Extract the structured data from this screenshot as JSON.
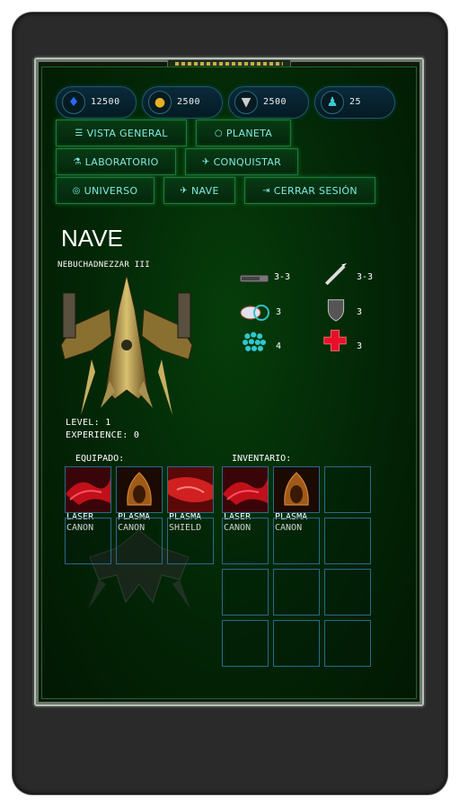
{
  "resources": [
    {
      "icon": "crystal-icon",
      "value": "12500",
      "color": "#2a6aff"
    },
    {
      "icon": "gold-icon",
      "value": "2500",
      "color": "#e8b020"
    },
    {
      "icon": "oil-icon",
      "value": "2500",
      "color": "#cccccc"
    },
    {
      "icon": "population-icon",
      "value": "25",
      "color": "#40c8d0"
    }
  ],
  "nav": {
    "vista_general": "VISTA GENERAL",
    "planeta": "PLANETA",
    "laboratorio": "LABORATORIO",
    "conquistar": "CONQUISTAR",
    "universo": "UNIVERSO",
    "nave": "NAVE",
    "cerrar_sesion": "CERRAR SESIÓN"
  },
  "page": {
    "title": "NAVE",
    "ship_name": "NEBUCHADNEZZAR III"
  },
  "stats": {
    "cannon": "3-3",
    "missile": "3-3",
    "thruster": "3",
    "shield": "3",
    "cells": "4",
    "repair": "3"
  },
  "ship_info": {
    "level": "LEVEL: 1",
    "experience": "EXPERIENCE: 0"
  },
  "equipped": {
    "label": "EQUIPADO:",
    "items": [
      {
        "name": "LASER\nCANON",
        "icon": "red-laser-icon"
      },
      {
        "name": "PLASMA\nCANON",
        "icon": "orange-plasma-icon"
      },
      {
        "name": "PLASMA\nSHIELD",
        "icon": "red-shield-icon"
      }
    ]
  },
  "inventory": {
    "label": "INVENTARIO:",
    "items": [
      {
        "name": "LASER\nCANON",
        "icon": "red-laser-icon"
      },
      {
        "name": "PLASMA\nCANON",
        "icon": "orange-plasma-icon"
      }
    ]
  }
}
